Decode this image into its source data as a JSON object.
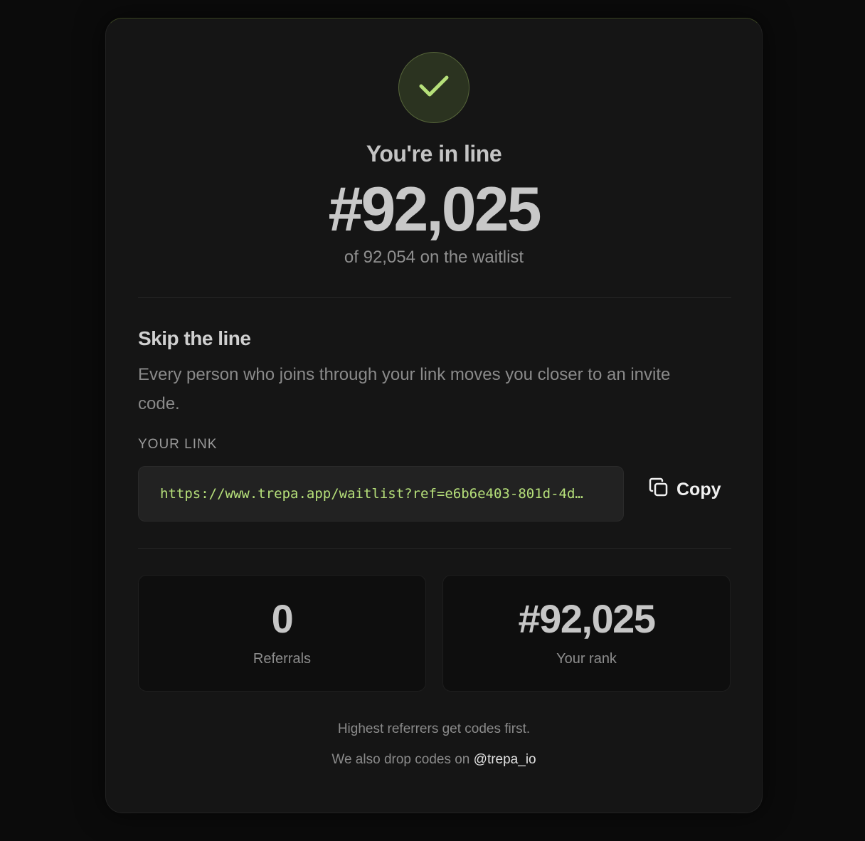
{
  "status": {
    "title": "You're in line",
    "position": "#92,025",
    "subtitle": "of 92,054 on the waitlist",
    "icon": "check-icon",
    "accent_color": "#b6e07a"
  },
  "referral": {
    "title": "Skip the line",
    "description": "Every person who joins through your link moves you closer to an invite code.",
    "link_label": "YOUR LINK",
    "link_value": "https://www.trepa.app/waitlist?ref=e6b6e403-801d-4d…",
    "copy_label": "Copy",
    "copy_icon": "copy-icon"
  },
  "stats": [
    {
      "value": "0",
      "label": "Referrals"
    },
    {
      "value": "#92,025",
      "label": "Your rank"
    }
  ],
  "footer": {
    "note": "Highest referrers get codes first.",
    "social_prefix": "We also drop codes on",
    "social_handle": "@trepa_io"
  }
}
